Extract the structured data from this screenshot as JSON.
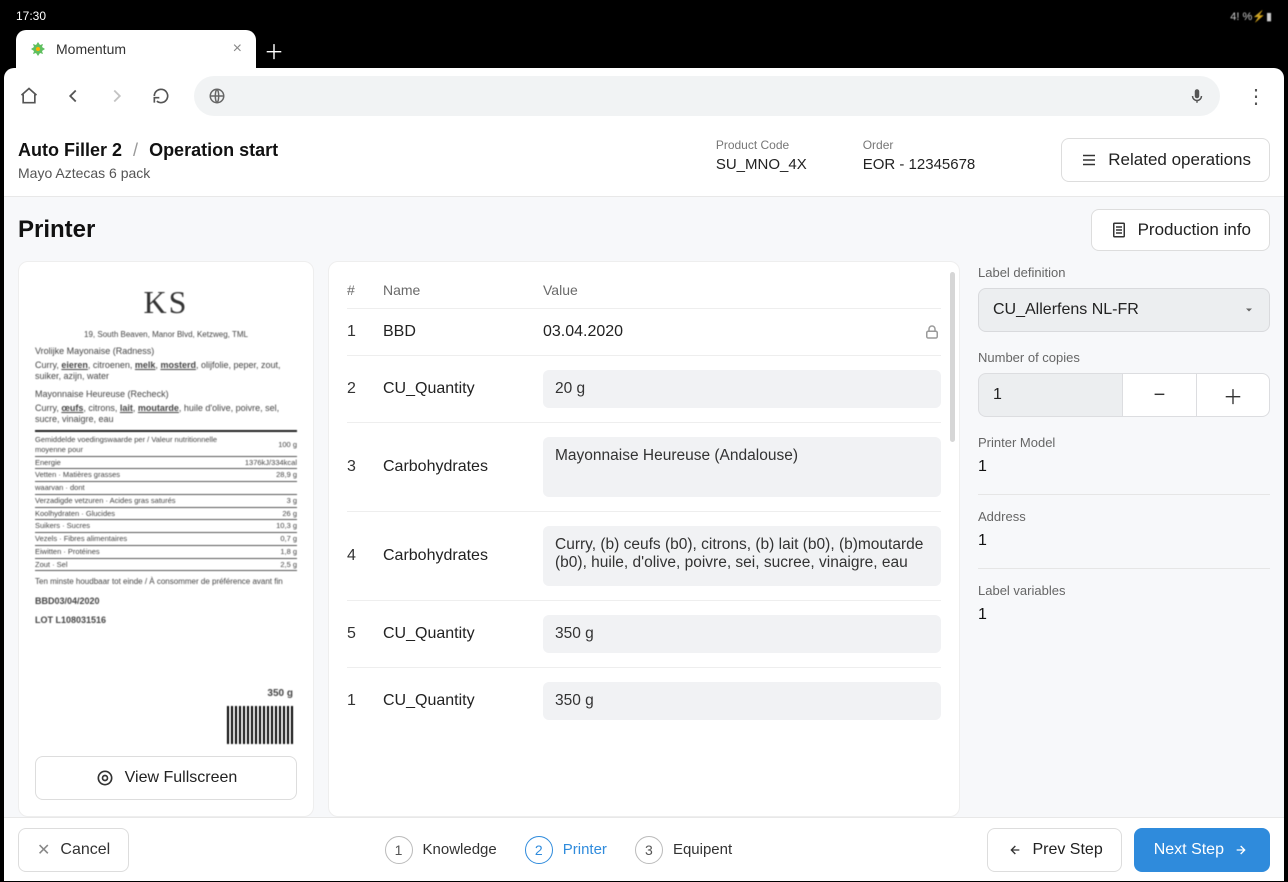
{
  "statusbar": {
    "time": "17:30",
    "right": "4! %⚡▮"
  },
  "tab": {
    "title": "Momentum"
  },
  "breadcrumb": {
    "a": "Auto Filler 2",
    "sep": "/",
    "b": "Operation start"
  },
  "subtitle": "Mayo Aztecas 6 pack",
  "meta": {
    "product_code_label": "Product Code",
    "product_code_value": "SU_MNO_4X",
    "order_label": "Order",
    "order_value": "EOR - 12345678"
  },
  "buttons": {
    "related_operations": "Related operations",
    "production_info": "Production info",
    "view_fullscreen": "View Fullscreen",
    "cancel": "Cancel",
    "prev_step": "Prev Step",
    "next_step": "Next Step"
  },
  "section_title": "Printer",
  "table": {
    "headers": {
      "num": "#",
      "name": "Name",
      "value": "Value"
    },
    "rows": [
      {
        "num": "1",
        "name": "BBD",
        "value": "03.04.2020",
        "locked": true,
        "plain": true
      },
      {
        "num": "2",
        "name": "CU_Quantity",
        "value": "20 g"
      },
      {
        "num": "3",
        "name": "Carbohydrates",
        "value": "Mayonnaise Heureuse (Andalouse)",
        "tall": true
      },
      {
        "num": "4",
        "name": "Carbohydrates",
        "value": "Curry, (b) ceufs (b0), citrons, (b) lait (b0), (b)moutarde (b0), huile, d'olive, poivre, sei, sucree, vinaigre, eau",
        "tall": true
      },
      {
        "num": "5",
        "name": "CU_Quantity",
        "value": "350 g"
      },
      {
        "num": "1",
        "name": "CU_Quantity",
        "value": "350 g"
      }
    ]
  },
  "config": {
    "label_definition_label": "Label definition",
    "label_definition_value": "CU_Allerfens NL-FR",
    "copies_label": "Number of copies",
    "copies_value": "1",
    "printer_model_label": "Printer Model",
    "printer_model_value": "1",
    "address_label": "Address",
    "address_value": "1",
    "label_vars_label": "Label variables",
    "label_vars_value": "1"
  },
  "steps": {
    "s1": {
      "num": "1",
      "label": "Knowledge"
    },
    "s2": {
      "num": "2",
      "label": "Printer"
    },
    "s3": {
      "num": "3",
      "label": "Equipent"
    }
  },
  "preview": {
    "logo": "KS",
    "addr": "19, South Beaven, Manor Blvd, Ketzweg, TML",
    "sect1": "Vrolijke Mayonaise (Radness)",
    "ingr1": "Curry, eieren, citroenen, melk, mosterd, olijfolie, peper, zout, suiker, azijn, water",
    "sect2": "Mayonnaise Heureuse (Recheck)",
    "ingr2": "Curry, œufs, citrons, lait, moutarde, huile d'olive, poivre, sel, sucre, vinaigre, eau",
    "nutri_head_l": "Gemiddelde voedingswaarde per / Valeur nutritionnelle moyenne pour",
    "nutri_head_r": "100 g",
    "rows": [
      [
        "Energie",
        "1376kJ/334kcal"
      ],
      [
        "Vetten · Matières grasses",
        "28,9 g"
      ],
      [
        "waarvan · dont",
        ""
      ],
      [
        "Verzadigde vetzuren · Acides gras saturés",
        "3 g"
      ],
      [
        "Koolhydraten · Glucides",
        "26 g"
      ],
      [
        "Suikers · Sucres",
        "10,3 g"
      ],
      [
        "Vezels · Fibres alimentaires",
        "0,7 g"
      ],
      [
        "Eiwitten · Protéines",
        "1,8 g"
      ],
      [
        "Zout · Sel",
        "2,5 g"
      ]
    ],
    "keep": "Ten minste houdbaar tot einde / À consommer de préférence avant fin",
    "wt": "350 g",
    "bbd": "BBD03/04/2020",
    "lot": "LOT L108031516"
  },
  "colors": {
    "accent": "#2f8bdc"
  }
}
